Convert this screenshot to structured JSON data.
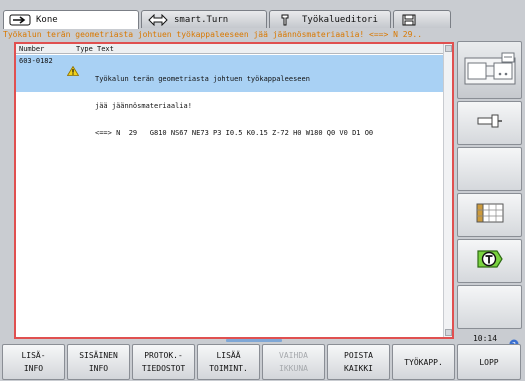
{
  "tabs": [
    {
      "label": "Kone",
      "icon": "arrow-right-icon",
      "active": true
    },
    {
      "label": "smart.Turn",
      "icon": "arrows-icon",
      "active": false
    },
    {
      "label": "Työkalueditori",
      "icon": "tool-holder-icon",
      "active": false
    },
    {
      "label": "",
      "icon": "save-icon",
      "active": false
    }
  ],
  "message": "Työkalun terän geometriasta johtuen työkappaleeseen jää jäännösmateriaalia! <==> N  29..",
  "table": {
    "headers": {
      "number": "Number",
      "type": "Type",
      "text": "Text"
    },
    "rows": [
      {
        "number": "603-0182",
        "type_icon": "warning-icon",
        "text_lines": [
          "Työkalun terän geometriasta johtuen työkappaleeseen",
          "jää jäännösmateriaalia!",
          "<==> N  29   G810 NS67 NE73 P3 I0.5 K0.15 Z-72 H0 W180 Q0 V0 D1 O0"
        ]
      }
    ]
  },
  "side_keys": [
    {
      "icon": "machine-mode-icon"
    },
    {
      "icon": "tool-holder-icon"
    },
    {
      "icon": "blank"
    },
    {
      "icon": "table-icon"
    },
    {
      "icon": "tool-t-icon"
    },
    {
      "icon": "blank"
    }
  ],
  "clock": "10:14",
  "softkeys": [
    {
      "line1": "LISÄ-",
      "line2": "INFO",
      "enabled": true
    },
    {
      "line1": "SISÄINEN",
      "line2": "INFO",
      "enabled": true
    },
    {
      "line1": "PROTOK.-",
      "line2": "TIEDOSTOT",
      "enabled": true
    },
    {
      "line1": "LISÄÄ",
      "line2": "TOIMINT.",
      "enabled": true
    },
    {
      "line1": "VAIHDA",
      "line2": "IKKUNA",
      "enabled": false
    },
    {
      "line1": "POISTA",
      "line2": "KAIKKI",
      "enabled": true
    },
    {
      "line1": "TYÖKAPP.",
      "line2": "",
      "enabled": true
    },
    {
      "line1": "LOPP",
      "line2": "",
      "enabled": true
    }
  ],
  "colors": {
    "message": "#d97800",
    "panel_border": "#e05050",
    "row_selected": "#a9d1f4",
    "background": "#c9ccd1"
  }
}
